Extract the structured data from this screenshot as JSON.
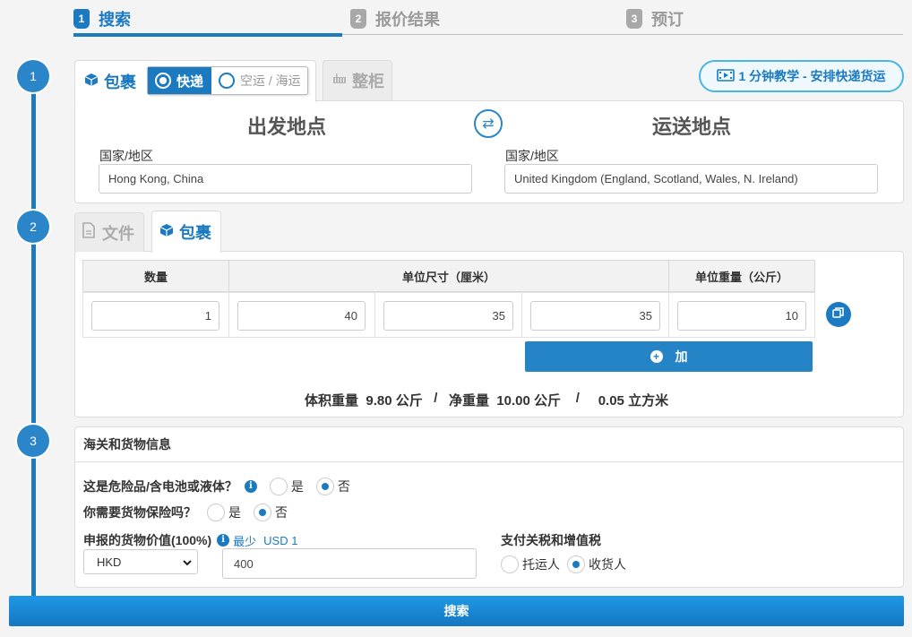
{
  "wizard": {
    "steps": [
      {
        "num": "1",
        "label": "搜索"
      },
      {
        "num": "2",
        "label": "报价结果"
      },
      {
        "num": "3",
        "label": "预订"
      }
    ]
  },
  "timeline": [
    "1",
    "2",
    "3"
  ],
  "shipment": {
    "tab_parcel": "包裹",
    "mode_express": "快递",
    "mode_air_sea": "空运 / 海运",
    "tab_container": "整柜",
    "tutorial_label": "1 分钟教学 - 安排快递货运",
    "origin_title": "出发地点",
    "destination_title": "运送地点",
    "origin_label": "国家/地区",
    "origin_value": "Hong Kong, China",
    "destination_label": "国家/地区",
    "destination_value": "United Kingdom (England, Scotland, Wales, N. Ireland)"
  },
  "package": {
    "tab_document": "文件",
    "tab_parcel": "包裹",
    "headers": {
      "qty": "数量",
      "dims": "单位尺寸（厘米）",
      "weight": "单位重量（公斤）"
    },
    "row": {
      "qty": "1",
      "length": "40",
      "width": "35",
      "height": "35",
      "weight": "10"
    },
    "add_label": "加",
    "summary": {
      "vol_label": "体积重量",
      "vol_value": "9.80 公斤",
      "sep1": "/",
      "net_label": "净重量",
      "net_value": "10.00 公斤",
      "sep2": "/",
      "cbm_value": "0.05 立方米"
    }
  },
  "customs": {
    "title": "海关和货物信息",
    "dangerous_q": "这是危险品/含电池或液体？",
    "insurance_q": "你需要货物保险吗？",
    "yes": "是",
    "no": "否",
    "declared_label": "申报的货物价值(100%)",
    "min_label": "最少",
    "min_value": "USD 1",
    "currency": "HKD",
    "declared_value": "400",
    "duty_label": "支付关税和增值税",
    "shipper": "托运人",
    "consignee": "收货人"
  },
  "search_label": "搜索",
  "colors": {
    "accent": "#1b7ac0",
    "button": "#2584c6"
  }
}
